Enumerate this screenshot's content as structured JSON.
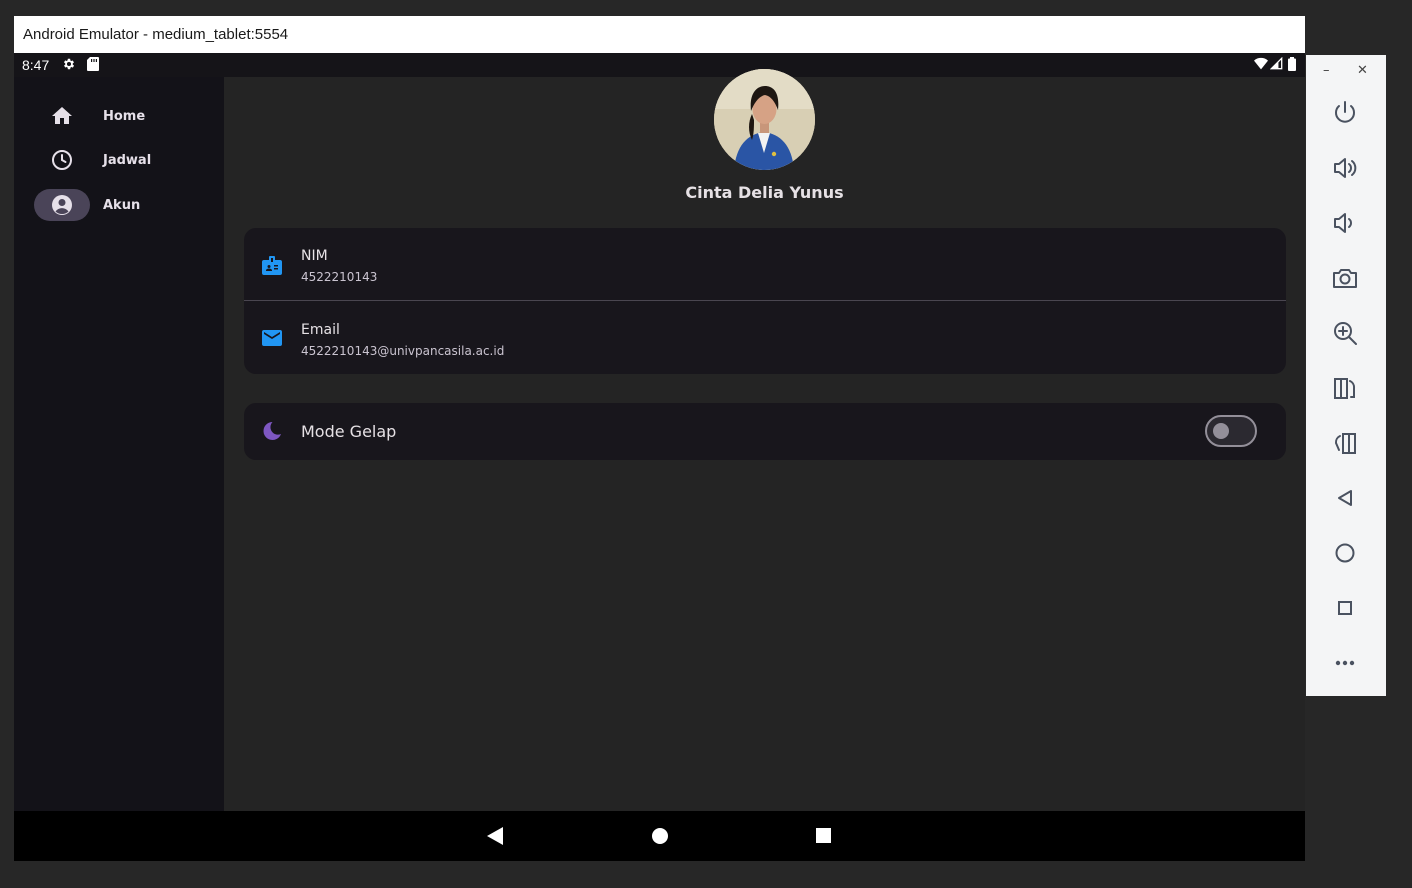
{
  "window": {
    "title": "Android Emulator - medium_tablet:5554"
  },
  "status_bar": {
    "time": "8:47",
    "icons": [
      "settings-icon",
      "sd-card-icon",
      "wifi-icon",
      "signal-icon",
      "battery-icon"
    ]
  },
  "nav_rail": {
    "items": [
      {
        "label": "Home",
        "icon": "home-icon",
        "active": false
      },
      {
        "label": "Jadwal",
        "icon": "clock-icon",
        "active": false
      },
      {
        "label": "Akun",
        "icon": "account-circle-icon",
        "active": true
      }
    ]
  },
  "profile": {
    "name": "Cinta Delia Yunus",
    "fields": [
      {
        "label": "NIM",
        "value": "4522210143",
        "icon": "badge-icon"
      },
      {
        "label": "Email",
        "value": "4522210143@univpancasila.ac.id",
        "icon": "mail-icon"
      }
    ]
  },
  "settings": {
    "dark_mode_label": "Mode Gelap",
    "dark_mode_on": false
  },
  "colors": {
    "accent_blue": "#2196f3",
    "accent_purple": "#7e57c2",
    "surface": "#18161c",
    "background": "#242424"
  },
  "emulator_controls": [
    "power-icon",
    "volume-up-icon",
    "volume-down-icon",
    "camera-icon",
    "zoom-in-icon",
    "rotate-left-icon",
    "rotate-right-icon",
    "back-icon",
    "home-circle-icon",
    "overview-square-icon",
    "more-icon"
  ]
}
